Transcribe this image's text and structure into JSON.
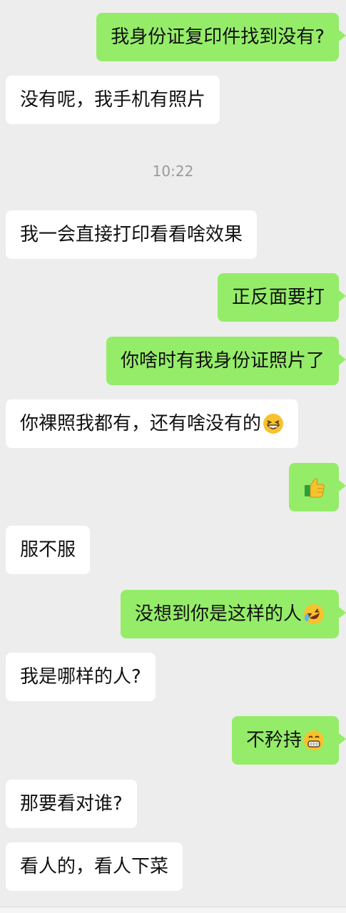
{
  "messages": [
    {
      "side": "out",
      "text": "我身份证复印件找到没有?"
    },
    {
      "side": "in",
      "text": "没有呢，我手机有照片"
    },
    {
      "time": "10:22"
    },
    {
      "side": "in",
      "text": "我一会直接打印看看啥效果"
    },
    {
      "side": "out",
      "text": "正反面要打"
    },
    {
      "side": "out",
      "text": "你啥时有我身份证照片了"
    },
    {
      "side": "in",
      "text": "你裸照我都有，还有啥没有的",
      "emoji": "grin-squint-emoji"
    },
    {
      "side": "out",
      "text": "",
      "emoji": "thumbs-up-emoji"
    },
    {
      "side": "in",
      "text": "服不服"
    },
    {
      "side": "out",
      "text": "没想到你是这样的人",
      "emoji": "rolling-laugh-emoji"
    },
    {
      "side": "in",
      "text": "我是哪样的人?"
    },
    {
      "side": "out",
      "text": "不矜持",
      "emoji": "beaming-grin-emoji"
    },
    {
      "side": "in",
      "text": "那要看对谁?"
    },
    {
      "side": "in",
      "text": "看人的，看人下菜"
    }
  ],
  "colors": {
    "background": "#ededed",
    "incoming_bubble": "#ffffff",
    "outgoing_bubble": "#95ec69",
    "timestamp": "#9a9a9a"
  }
}
